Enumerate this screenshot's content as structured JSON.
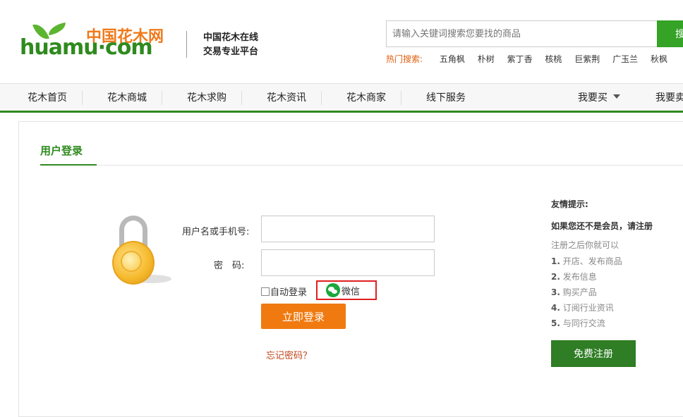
{
  "header": {
    "logo_cn": "中国花木网",
    "logo_en": "huamu·com",
    "slogan_line1": "中国花木在线",
    "slogan_line2": "交易专业平台",
    "search_placeholder": "请输入关键词搜索您要找的商品",
    "search_button": "搜",
    "hot_label": "热门搜索:",
    "hot_keywords": [
      "五角枫",
      "朴树",
      "紫丁香",
      "核桃",
      "巨紫荆",
      "广玉兰",
      "秋枫"
    ]
  },
  "nav": {
    "items": [
      "花木首页",
      "花木商城",
      "花木求购",
      "花木资讯",
      "花木商家",
      "线下服务"
    ],
    "buy": "我要买",
    "sell": "我要卖"
  },
  "login": {
    "tab_title": "用户登录",
    "username_label": "用户名或手机号:",
    "password_label": "密　码:",
    "username_value": "",
    "password_value": "",
    "auto_login": "自动登录",
    "wechat": "微信",
    "submit": "立即登录",
    "forgot": "忘记密码？"
  },
  "tips": {
    "title": "友情提示:",
    "subtitle": "如果您还不是会员，请注册",
    "intro": "注册之后你就可以",
    "items": [
      {
        "num": "1.",
        "text": "开店、发布商品"
      },
      {
        "num": "2.",
        "text": "发布信息"
      },
      {
        "num": "3.",
        "text": "购买产品"
      },
      {
        "num": "4.",
        "text": "订阅行业资讯"
      },
      {
        "num": "5.",
        "text": "与同行交流"
      }
    ],
    "register": "免费注册"
  },
  "colors": {
    "brand_green": "#2f8a1f",
    "brand_orange": "#f07a1b",
    "login_button": "#f07a10",
    "register_button": "#2f7d24",
    "highlight_box": "#e02020"
  }
}
